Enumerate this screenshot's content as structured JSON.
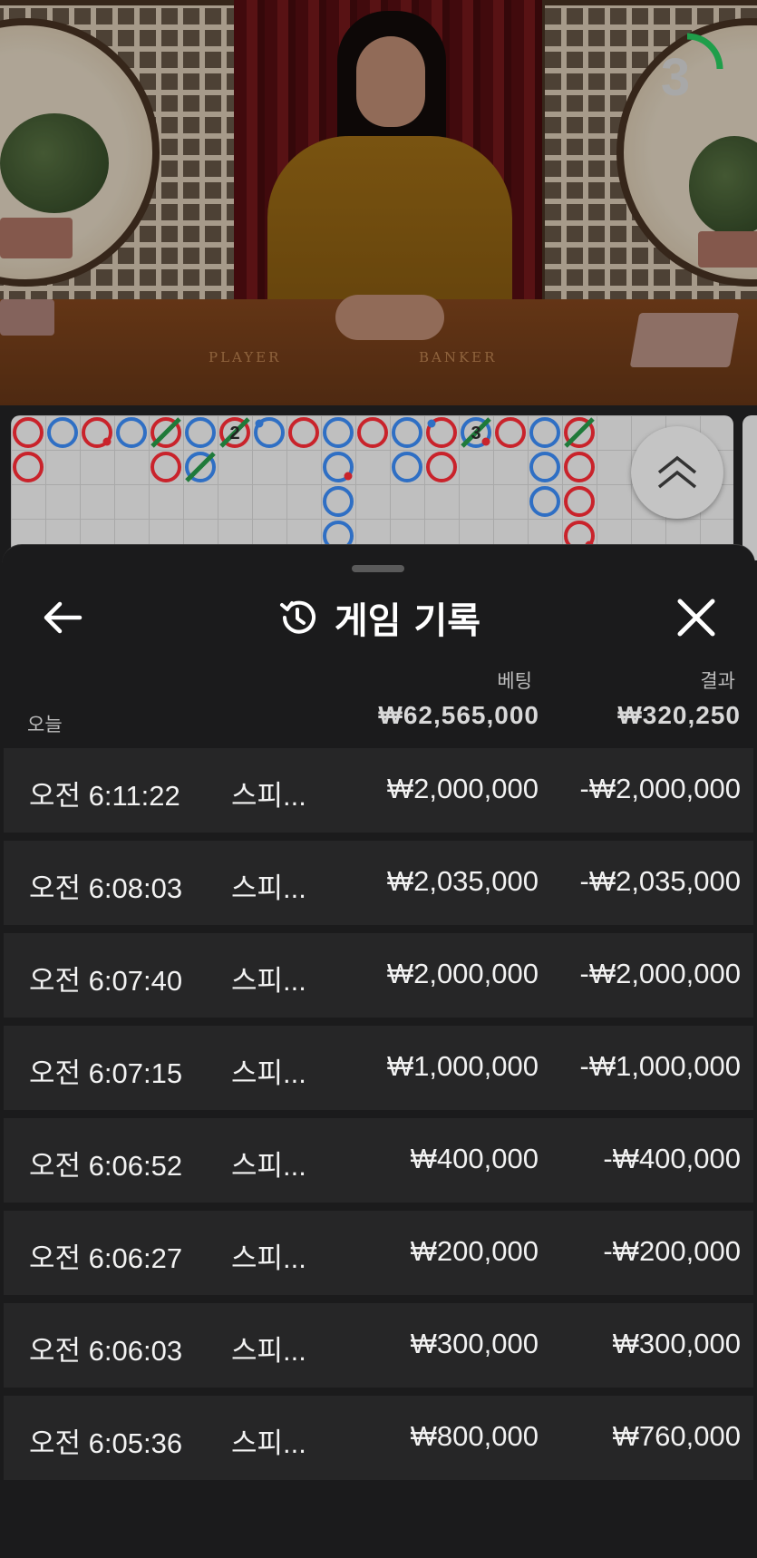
{
  "video": {
    "countdown": "3",
    "countdown_fraction": 0.25,
    "table_labels": {
      "player": "PLAYER",
      "banker": "BANKER"
    }
  },
  "roadmap": {
    "colors": {
      "player": "#2f6fc4",
      "banker": "#c9232b",
      "tie": "#1f7a3a"
    },
    "cells": [
      {
        "col": 0,
        "row": 0,
        "type": "banker"
      },
      {
        "col": 0,
        "row": 1,
        "type": "banker"
      },
      {
        "col": 1,
        "row": 0,
        "type": "player"
      },
      {
        "col": 2,
        "row": 0,
        "type": "banker",
        "mark": "player-pair"
      },
      {
        "col": 3,
        "row": 0,
        "type": "player"
      },
      {
        "col": 4,
        "row": 0,
        "type": "banker",
        "tie": true
      },
      {
        "col": 4,
        "row": 1,
        "type": "banker"
      },
      {
        "col": 5,
        "row": 0,
        "type": "player"
      },
      {
        "col": 5,
        "row": 1,
        "type": "player",
        "tie": true
      },
      {
        "col": 6,
        "row": 0,
        "type": "banker",
        "tie": true,
        "tie_count": "2"
      },
      {
        "col": 7,
        "row": 0,
        "type": "player",
        "mark": "banker-pair"
      },
      {
        "col": 8,
        "row": 0,
        "type": "banker"
      },
      {
        "col": 9,
        "row": 0,
        "type": "player"
      },
      {
        "col": 9,
        "row": 1,
        "type": "player",
        "mark": "player-pair"
      },
      {
        "col": 9,
        "row": 2,
        "type": "player"
      },
      {
        "col": 9,
        "row": 3,
        "type": "player"
      },
      {
        "col": 10,
        "row": 0,
        "type": "banker"
      },
      {
        "col": 11,
        "row": 0,
        "type": "player"
      },
      {
        "col": 11,
        "row": 1,
        "type": "player"
      },
      {
        "col": 12,
        "row": 0,
        "type": "banker",
        "mark": "banker-pair"
      },
      {
        "col": 12,
        "row": 1,
        "type": "banker"
      },
      {
        "col": 13,
        "row": 0,
        "type": "player",
        "tie": true,
        "tie_count": "3",
        "mark": "player-pair"
      },
      {
        "col": 14,
        "row": 0,
        "type": "banker"
      },
      {
        "col": 15,
        "row": 0,
        "type": "player"
      },
      {
        "col": 15,
        "row": 1,
        "type": "player"
      },
      {
        "col": 15,
        "row": 2,
        "type": "player"
      },
      {
        "col": 16,
        "row": 0,
        "type": "banker",
        "tie": true
      },
      {
        "col": 16,
        "row": 1,
        "type": "banker"
      },
      {
        "col": 16,
        "row": 2,
        "type": "banker"
      },
      {
        "col": 16,
        "row": 3,
        "type": "banker",
        "mark": "player-pair"
      }
    ]
  },
  "history": {
    "title": "게임 기록",
    "col_bet": "베팅",
    "col_result": "결과",
    "today_label": "오늘",
    "today_bet_total": "₩62,565,000",
    "today_result_total": "₩320,250",
    "rows": [
      {
        "time": "오전 6:11:22",
        "game": "스피...",
        "bet": "₩2,000,000",
        "result": "-₩2,000,000"
      },
      {
        "time": "오전 6:08:03",
        "game": "스피...",
        "bet": "₩2,035,000",
        "result": "-₩2,035,000"
      },
      {
        "time": "오전 6:07:40",
        "game": "스피...",
        "bet": "₩2,000,000",
        "result": "-₩2,000,000"
      },
      {
        "time": "오전 6:07:15",
        "game": "스피...",
        "bet": "₩1,000,000",
        "result": "-₩1,000,000"
      },
      {
        "time": "오전 6:06:52",
        "game": "스피...",
        "bet": "₩400,000",
        "result": "-₩400,000"
      },
      {
        "time": "오전 6:06:27",
        "game": "스피...",
        "bet": "₩200,000",
        "result": "-₩200,000"
      },
      {
        "time": "오전 6:06:03",
        "game": "스피...",
        "bet": "₩300,000",
        "result": "₩300,000"
      },
      {
        "time": "오전 6:05:36",
        "game": "스피...",
        "bet": "₩800,000",
        "result": "₩760,000"
      }
    ]
  }
}
